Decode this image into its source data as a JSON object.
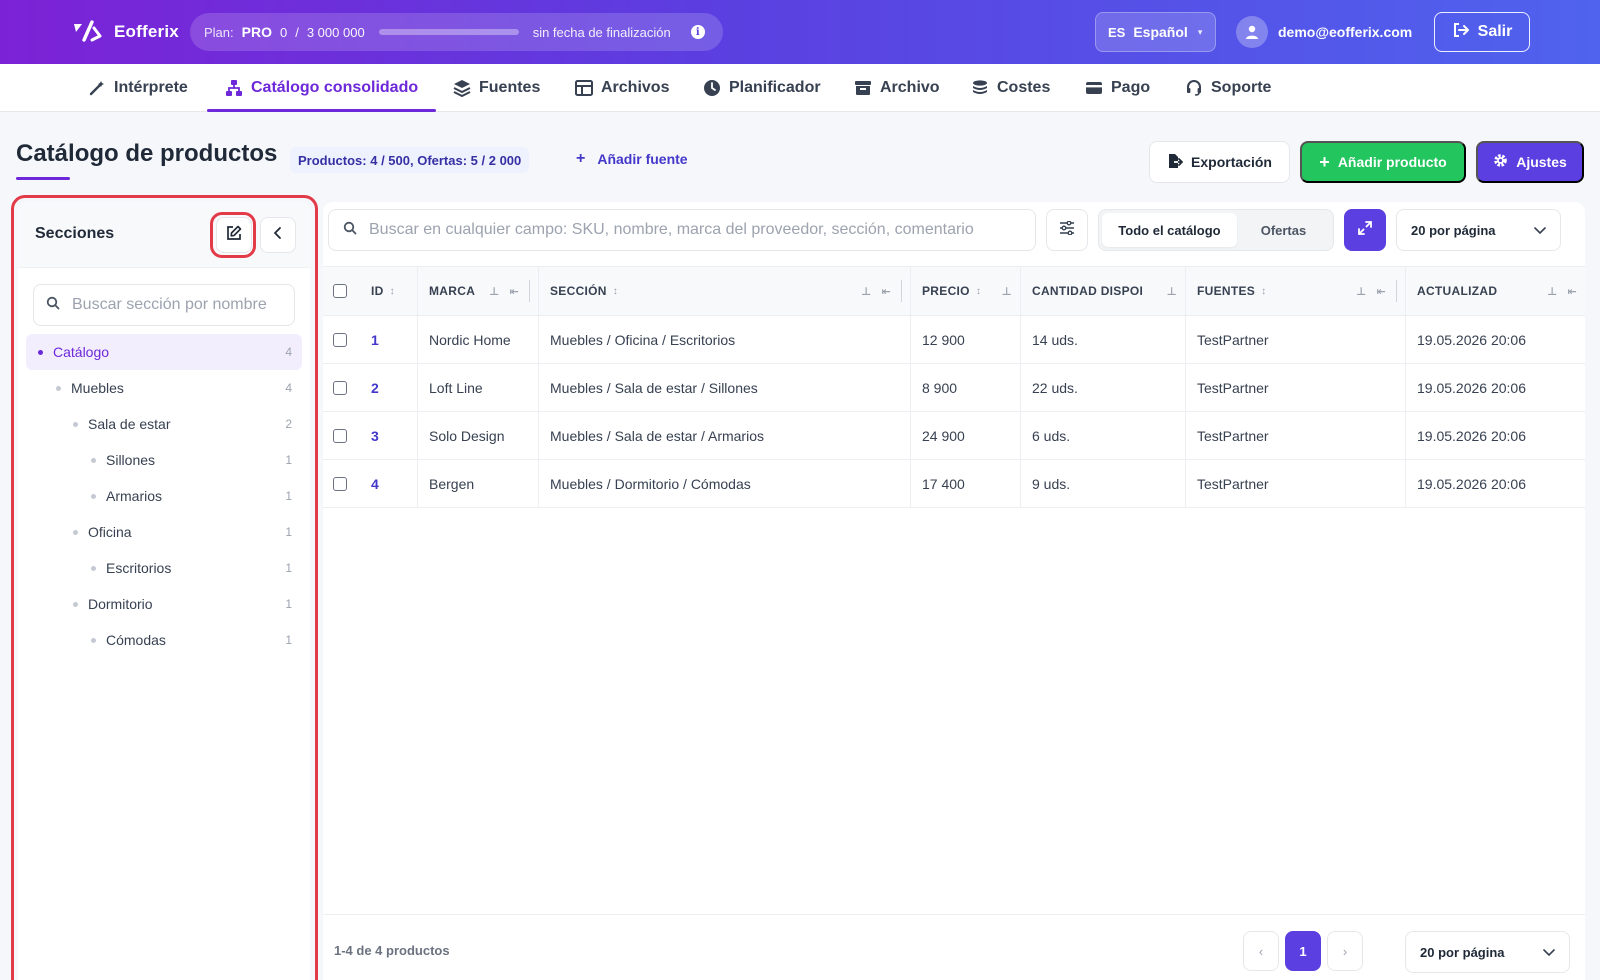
{
  "app": {
    "name": "Eofferix"
  },
  "plan": {
    "label": "Plan:",
    "tier": "PRO",
    "used": "0",
    "sep": "/",
    "limit": "3 000 000",
    "usage_fraction": 0.0,
    "end_text": "sin fecha de finalización",
    "info_glyph": "i"
  },
  "language": {
    "code": "ES",
    "name": "Español",
    "caret": "▾"
  },
  "user": {
    "email": "demo@eofferix.com"
  },
  "logout": {
    "label": "Salir"
  },
  "nav": {
    "items": [
      {
        "label": "Intérprete",
        "icon": "wand-icon"
      },
      {
        "label": "Catálogo consolidado",
        "icon": "sitemap-icon",
        "active": true
      },
      {
        "label": "Fuentes",
        "icon": "layers-icon"
      },
      {
        "label": "Archivos",
        "icon": "table-icon"
      },
      {
        "label": "Planificador",
        "icon": "clock-icon"
      },
      {
        "label": "Archivo",
        "icon": "archive-icon"
      },
      {
        "label": "Costes",
        "icon": "coins-icon"
      },
      {
        "label": "Pago",
        "icon": "card-icon"
      },
      {
        "label": "Soporte",
        "icon": "headset-icon"
      }
    ]
  },
  "page": {
    "title": "Catálogo de productos",
    "stats": "Productos: 4 / 500, Ofertas: 5 / 2 000",
    "add_source": "Añadir fuente",
    "add_glyph": "+",
    "export_label": "Exportación",
    "add_product_label": "Añadir producto",
    "settings_label": "Ajustes"
  },
  "sidebar": {
    "title": "Secciones",
    "search_placeholder": "Buscar sección por nombre",
    "tree": [
      {
        "label": "Catálogo",
        "count": "4",
        "level": 0,
        "active": true
      },
      {
        "label": "Muebles",
        "count": "4",
        "level": 1
      },
      {
        "label": "Sala de estar",
        "count": "2",
        "level": 2
      },
      {
        "label": "Sillones",
        "count": "1",
        "level": 3
      },
      {
        "label": "Armarios",
        "count": "1",
        "level": 3
      },
      {
        "label": "Oficina",
        "count": "1",
        "level": 2
      },
      {
        "label": "Escritorios",
        "count": "1",
        "level": 3
      },
      {
        "label": "Dormitorio",
        "count": "1",
        "level": 2
      },
      {
        "label": "Cómodas",
        "count": "1",
        "level": 3
      }
    ]
  },
  "toolbar": {
    "search_placeholder": "Buscar en cualquier campo: SKU, nombre, marca del proveedor, sección, comentario",
    "segments": [
      "Todo el catálogo",
      "Ofertas"
    ],
    "per_page": "20 por página"
  },
  "table": {
    "columns": [
      "ID",
      "MARCA",
      "SECCIÓN",
      "PRECIO",
      "CANTIDAD DISPOI",
      "FUENTES",
      "ACTUALIZAD"
    ],
    "rows": [
      {
        "id": "1",
        "brand": "Nordic Home",
        "section": "Muebles / Oficina / Escritorios",
        "price": "12 900",
        "qty": "14 uds.",
        "source": "TestPartner",
        "updated": "19.05.2026 20:06"
      },
      {
        "id": "2",
        "brand": "Loft Line",
        "section": "Muebles / Sala de estar / Sillones",
        "price": "8 900",
        "qty": "22 uds.",
        "source": "TestPartner",
        "updated": "19.05.2026 20:06"
      },
      {
        "id": "3",
        "brand": "Solo Design",
        "section": "Muebles / Sala de estar / Armarios",
        "price": "24 900",
        "qty": "6 uds.",
        "source": "TestPartner",
        "updated": "19.05.2026 20:06"
      },
      {
        "id": "4",
        "brand": "Bergen",
        "section": "Muebles / Dormitorio / Cómodas",
        "price": "17 400",
        "qty": "9 uds.",
        "source": "TestPartner",
        "updated": "19.05.2026 20:06"
      }
    ]
  },
  "footer": {
    "count_text": "1-4 de 4 productos",
    "prev": "‹",
    "current_page": "1",
    "next": "›",
    "per_page": "20 por página"
  }
}
